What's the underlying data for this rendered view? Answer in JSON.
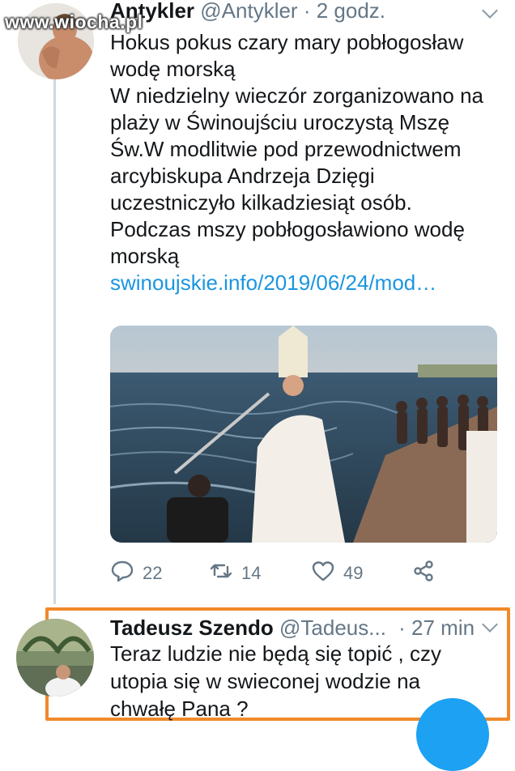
{
  "watermark": "www.wiocha.pl",
  "tweet": {
    "display_name": "Antykler",
    "handle": "@Antykler",
    "time": "· 2 godz.",
    "lines": [
      "Hokus pokus czary mary pobłogosław",
      "wodę morską",
      "W niedzielny wieczór zorganizowano na",
      "plaży w Świnoujściu uroczystą Mszę",
      "Św.W modlitwie pod przewodnictwem",
      "arcybiskupa Andrzeja Dzięgi",
      "uczestniczyło kilkadziesiąt osób.",
      "Podczas mszy pobłogosławiono wodę",
      "morską"
    ],
    "link": "swinoujskie.info/2019/06/24/mod…",
    "reply_count": "22",
    "retweet_count": "14",
    "like_count": "49"
  },
  "reply": {
    "display_name": "Tadeusz Szendo",
    "handle": "@Tadeus...",
    "time": "· 27 min",
    "lines": [
      "Teraz ludzie nie będą się topić , czy",
      "utopia się w swieconej wodzie na",
      "chwałę Pana ?"
    ]
  },
  "icons": {
    "reply": "speech-bubble-icon",
    "retweet": "retweet-icon",
    "like": "heart-icon",
    "share": "share-icon",
    "more": "chevron-down-icon"
  },
  "colors": {
    "link": "#1b95e0",
    "highlight_border": "#f08a2a",
    "muted": "#657786",
    "fab": "#1da1f2"
  }
}
